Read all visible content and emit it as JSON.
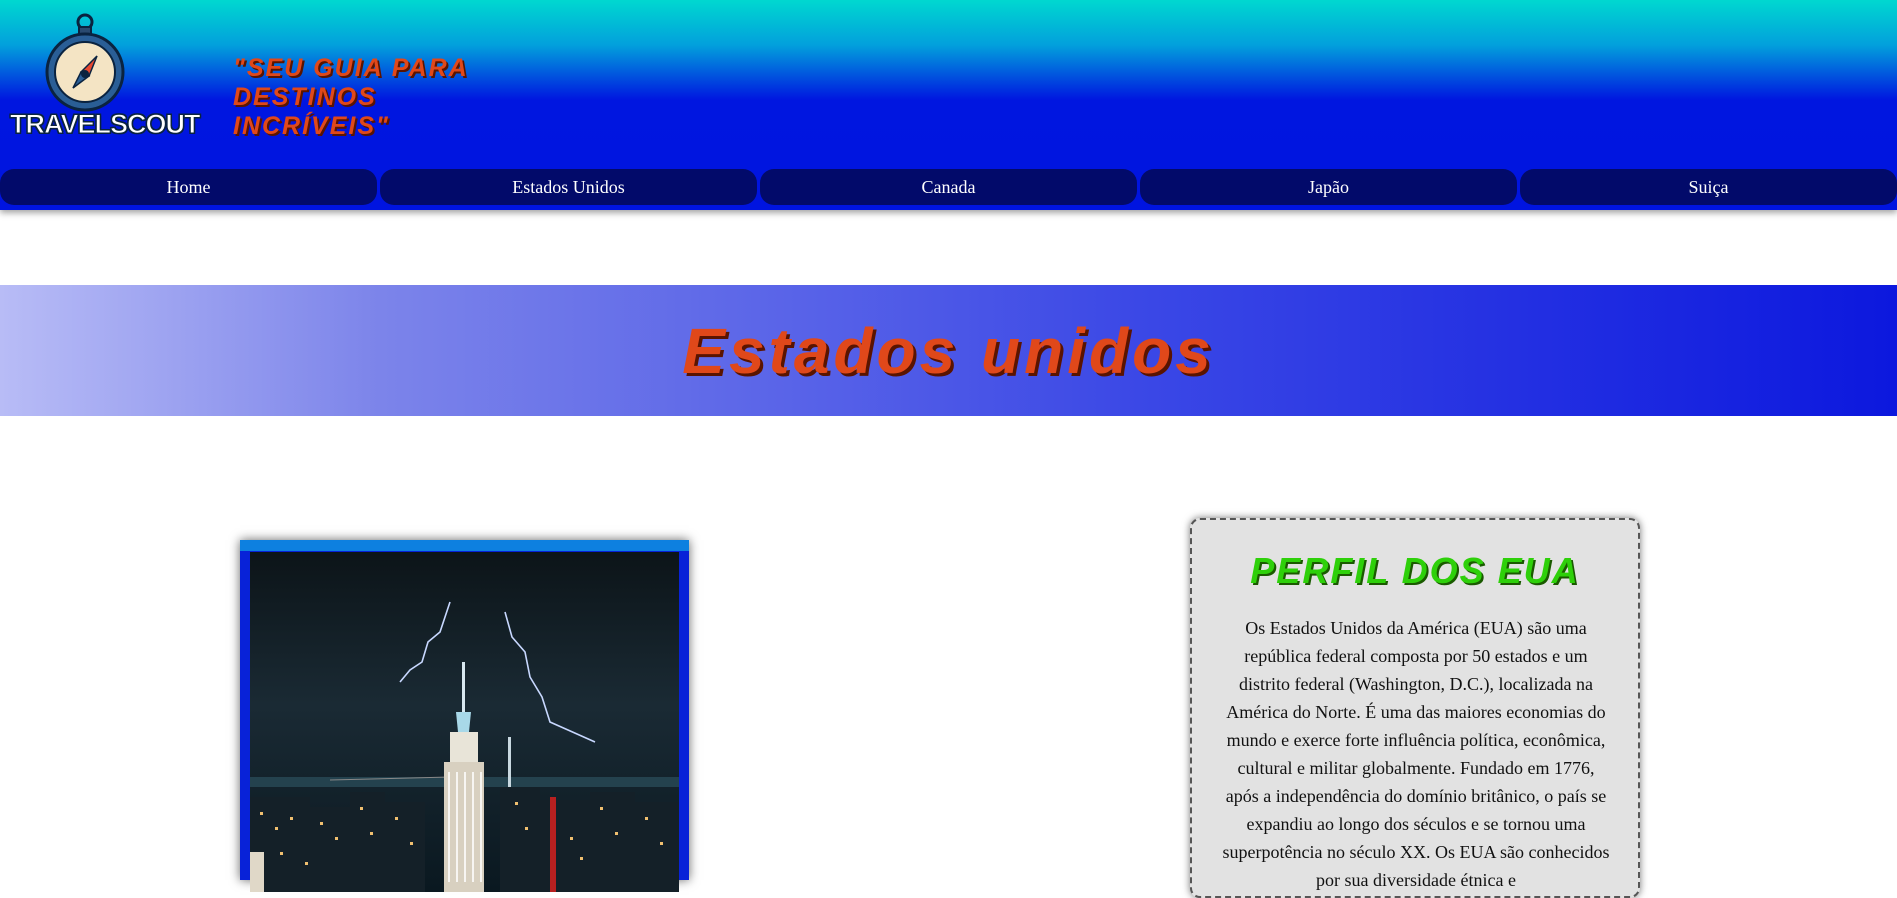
{
  "header": {
    "logo_text": "TRAVELSCOUT",
    "slogan": "\"Seu guia para destinos incríveis\""
  },
  "nav": {
    "items": [
      {
        "label": "Home"
      },
      {
        "label": "Estados Unidos"
      },
      {
        "label": "Canada"
      },
      {
        "label": "Japão"
      },
      {
        "label": "Suiça"
      }
    ]
  },
  "page": {
    "title": "Estados unidos"
  },
  "profile": {
    "title": "perfil dos EUA",
    "text": "Os Estados Unidos da América (EUA) são uma república federal composta por 50 estados e um distrito federal (Washington, D.C.), localizada na América do Norte. É uma das maiores economias do mundo e exerce forte influência política, econômica, cultural e militar globalmente. Fundado em 1776, após a independência do domínio britânico, o país se expandiu ao longo dos séculos e se tornou uma superpotência no século XX. Os EUA são conhecidos por sua diversidade étnica e"
  },
  "colors": {
    "accent": "#e0481a",
    "nav_bg": "#020a6a",
    "header_blue": "#0014e0",
    "profile_title": "#2ed00a"
  },
  "icons": {
    "logo": "compass-icon",
    "photo": "city-skyline-image"
  }
}
